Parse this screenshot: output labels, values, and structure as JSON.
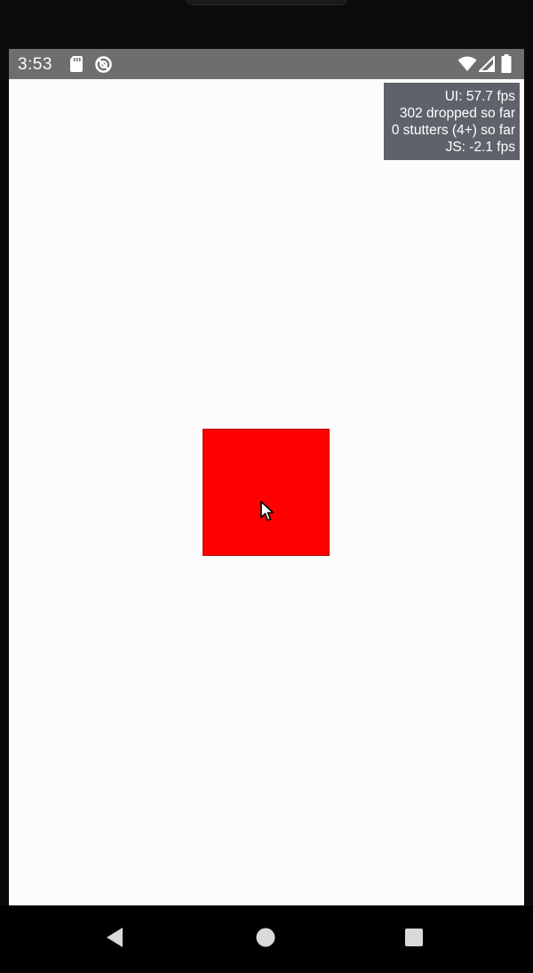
{
  "status_bar": {
    "time": "3:53",
    "icons_left": [
      "sd-card-icon",
      "sync-disabled-icon"
    ],
    "icons_right": [
      "wifi-icon",
      "cell-signal-icon",
      "battery-icon"
    ]
  },
  "perf_monitor": {
    "lines": [
      "UI: 57.7 fps",
      "302 dropped so far",
      "0 stutters (4+) so far",
      "JS: -2.1 fps"
    ]
  },
  "content": {
    "box_color": "#ff0000",
    "background_color": "#fdfcfd"
  },
  "nav_bar": {
    "buttons": [
      "back-icon",
      "home-icon",
      "recents-icon"
    ]
  }
}
